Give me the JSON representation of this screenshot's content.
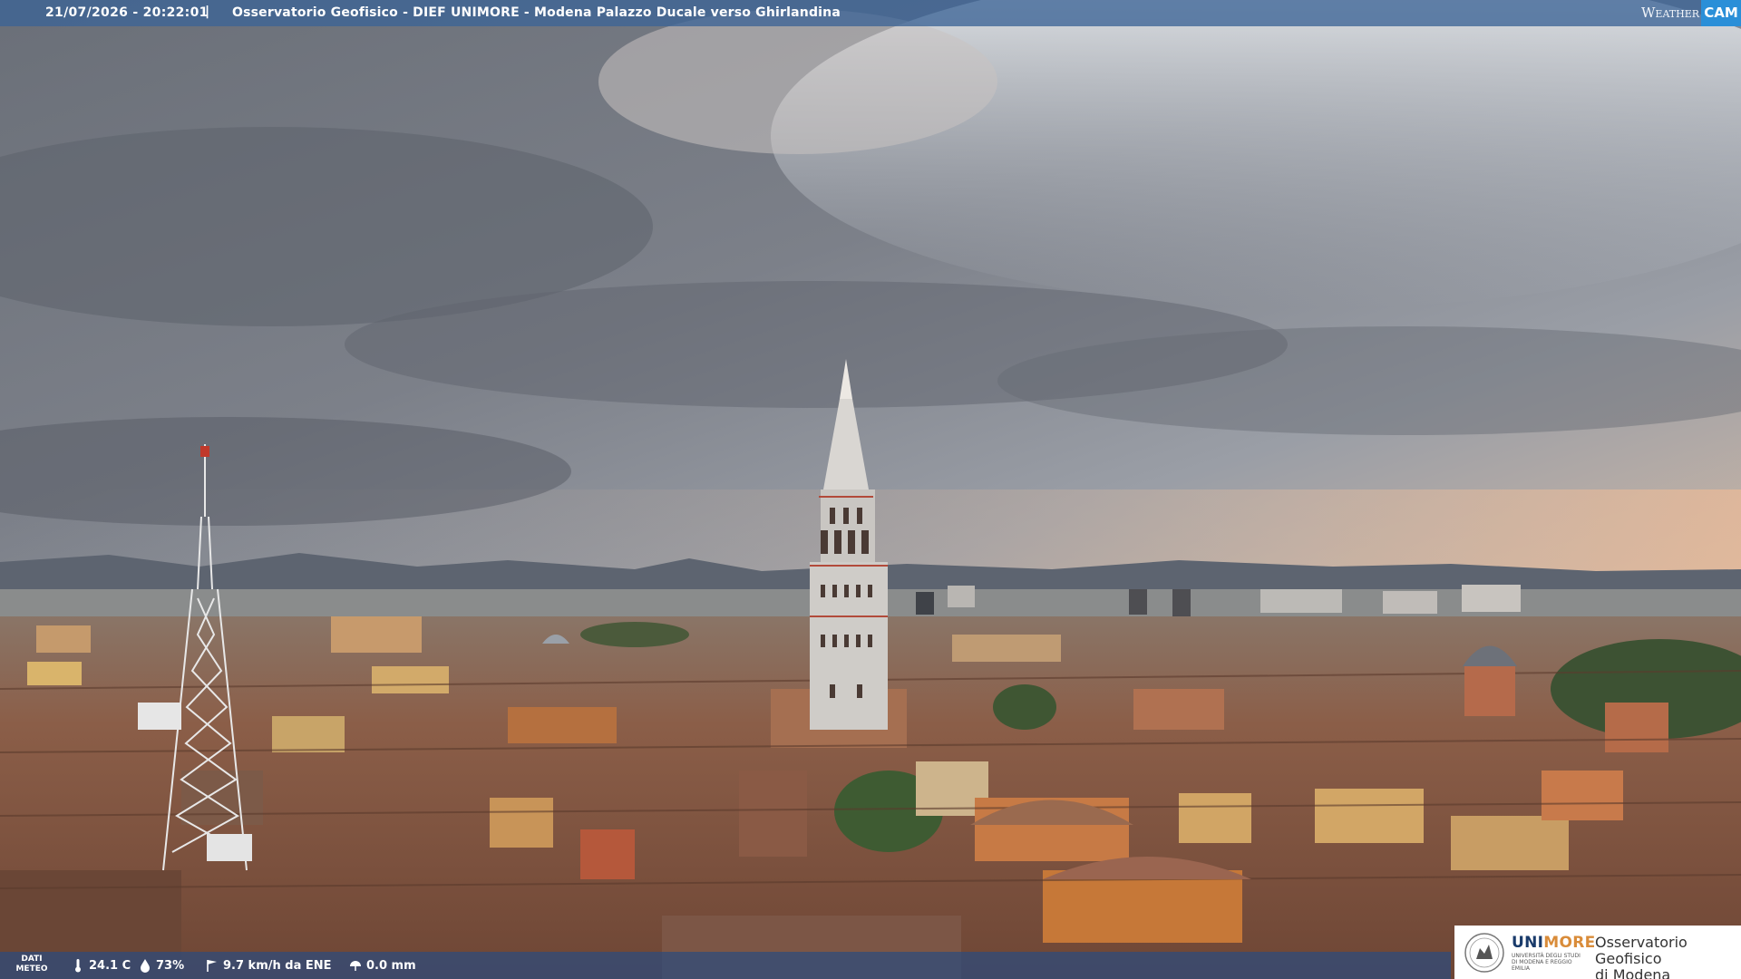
{
  "header": {
    "timestamp": "21/07/2026 - 20:22:01",
    "separator": "|",
    "title": "Osservatorio Geofisico - DIEF UNIMORE - Modena Palazzo Ducale verso Ghirlandina"
  },
  "weathercam_logo": {
    "word": "Weather",
    "cam": "CAM"
  },
  "meteo": {
    "label": "DATI METEO",
    "temperature": "24.1 C",
    "humidity": "73%",
    "wind": "9.7 km/h da ENE",
    "rain": "0.0 mm",
    "icons": [
      "thermometer-icon",
      "humidity-icon",
      "wind-icon",
      "rain-icon"
    ]
  },
  "logo": {
    "brand_main": "UNI",
    "brand_accent": "MORE",
    "brand_sub": "UNIVERSITÀ DEGLI STUDI DI MODENA E REGGIO EMILIA",
    "org_line1": "Osservatorio Geofisico",
    "org_line2": "di Modena"
  },
  "colors": {
    "bar": "#3c6496",
    "cam_accent": "#2a8fd8",
    "brand_blue": "#1a3b6b",
    "brand_orange": "#d98c3a"
  }
}
